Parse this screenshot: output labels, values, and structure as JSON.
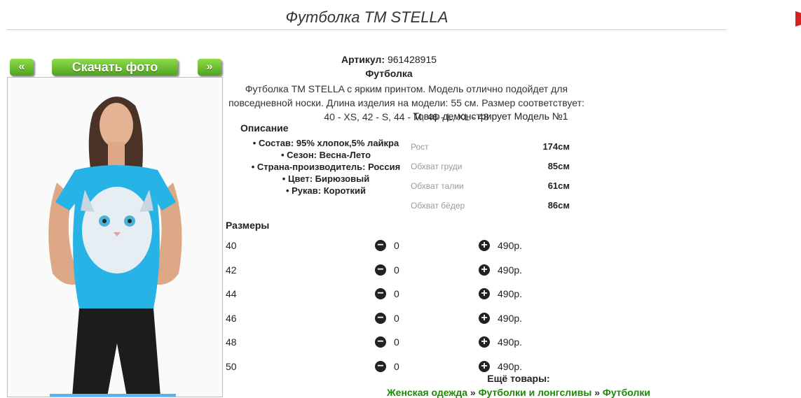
{
  "page_title": "Футболка TM STELLA",
  "nav": {
    "prev_label": "«",
    "download_label": "Скачать фото",
    "next_label": "»"
  },
  "product": {
    "article_label": "Артикул:",
    "article_value": "961428915",
    "type": "Футболка",
    "description": "Футболка TM STELLA с ярким принтом. Модель отлично подойдет для повседневной носки. Длина изделия на модели: 55 см. Размер соответствует: 40 - XS, 42 - S, 44 - M, 46 - L, XL - 48",
    "model_note": "Товар демонстрирует Модель №1"
  },
  "description_block": {
    "heading": "Описание",
    "items": [
      "Состав: 95% хлопок,5% лайкра",
      "Сезон: Весна-Лето",
      "Страна-производитель: Россия",
      "Цвет: Бирюзовый",
      "Рукав: Короткий"
    ]
  },
  "measurements": [
    {
      "label": "Рост",
      "value": "174см"
    },
    {
      "label": "Обхват груди",
      "value": "85см"
    },
    {
      "label": "Обхват талии",
      "value": "61см"
    },
    {
      "label": "Обхват бёдер",
      "value": "86см"
    }
  ],
  "sizes": {
    "heading": "Размеры",
    "rows": [
      {
        "size": "40",
        "qty": "0",
        "price": "490р."
      },
      {
        "size": "42",
        "qty": "0",
        "price": "490р."
      },
      {
        "size": "44",
        "qty": "0",
        "price": "490р."
      },
      {
        "size": "46",
        "qty": "0",
        "price": "490р."
      },
      {
        "size": "48",
        "qty": "0",
        "price": "490р."
      },
      {
        "size": "50",
        "qty": "0",
        "price": "490р."
      }
    ]
  },
  "more_products": {
    "label": "Ещё товары:",
    "links": [
      "Женская одежда",
      "Футболки и лонгсливы",
      "Футболки"
    ],
    "separator": "»"
  },
  "icons": {
    "minus": "minus-circle-icon",
    "plus": "plus-circle-icon"
  },
  "colors": {
    "button_green": "#5cb82a",
    "link_green": "#1a8a00",
    "shirt_turquoise": "#27b3e6"
  }
}
